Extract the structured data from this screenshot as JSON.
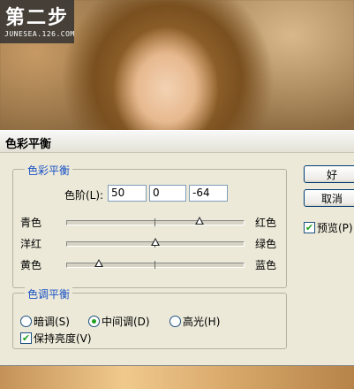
{
  "badge": {
    "title": "第二步",
    "site": "JUNESEA.126.COM"
  },
  "dialog": {
    "title": "色彩平衡",
    "group1_legend": "色彩平衡",
    "levels_label": "色阶(L):",
    "levels": [
      "50",
      "0",
      "-64"
    ],
    "sliders": [
      {
        "left": "青色",
        "right": "红色",
        "value": 50
      },
      {
        "left": "洋红",
        "right": "绿色",
        "value": 0
      },
      {
        "left": "黄色",
        "right": "蓝色",
        "value": -64
      }
    ],
    "group2_legend": "色调平衡",
    "tones": [
      {
        "label": "暗调(S)",
        "selected": false
      },
      {
        "label": "中间调(D)",
        "selected": true
      },
      {
        "label": "高光(H)",
        "selected": false
      }
    ],
    "preserve_luminosity": {
      "label": "保持亮度(V)",
      "checked": true
    },
    "ok_label": "好",
    "cancel_label": "取消",
    "preview": {
      "label": "预览(P)",
      "checked": true
    }
  }
}
